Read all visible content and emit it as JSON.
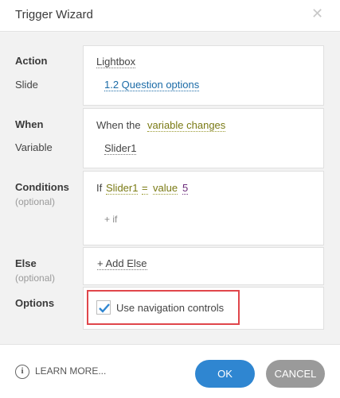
{
  "window": {
    "title": "Trigger Wizard"
  },
  "action": {
    "label": "Action",
    "value": "Lightbox",
    "slide_label": "Slide",
    "slide_value": "1.2 Question options"
  },
  "when": {
    "label": "When",
    "prefix": "When the",
    "event": "variable changes",
    "variable_label": "Variable",
    "variable_value": "Slider1"
  },
  "conditions": {
    "label": "Conditions",
    "optional": "(optional)",
    "if_word": "If",
    "variable": "Slider1",
    "operator": "=",
    "type": "value",
    "value": "5",
    "add_if": "+ if"
  },
  "else": {
    "label": "Else",
    "optional": "(optional)",
    "add_else": "+ Add Else"
  },
  "options": {
    "label": "Options",
    "use_nav_label": "Use navigation controls",
    "use_nav_checked": true
  },
  "footer": {
    "learn_more": "LEARN MORE...",
    "ok": "OK",
    "cancel": "CANCEL"
  },
  "colors": {
    "accent": "#2f86d1",
    "highlight_border": "#e0464b",
    "check": "#2f86d1"
  }
}
